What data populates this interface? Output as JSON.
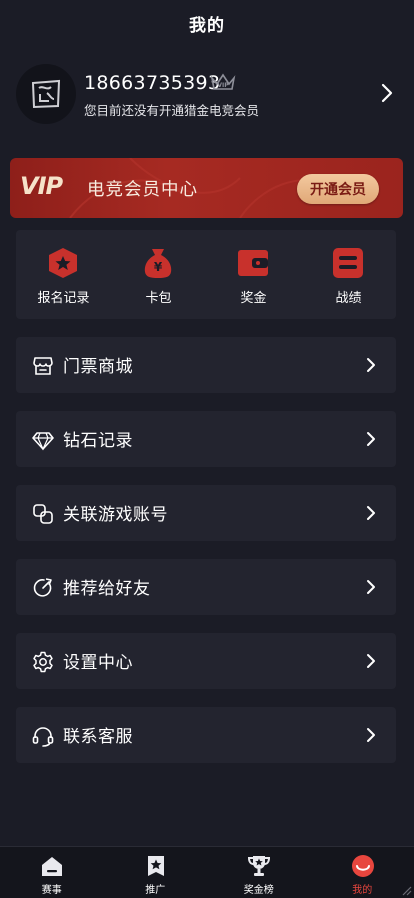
{
  "header": {
    "title": "我的"
  },
  "profile": {
    "phone": "18663735393",
    "subtext": "您目前还没有开通猎金电竞会员",
    "crown_label": "VIP"
  },
  "vip_banner": {
    "logo": "VIP",
    "title": "电竞会员中心",
    "button_label": "开通会员",
    "colors": {
      "background": "#9b241e",
      "button": "#e9b88a",
      "button_text": "#7a1b14"
    }
  },
  "quick_actions": [
    {
      "label": "报名记录",
      "icon": "registration-icon"
    },
    {
      "label": "卡包",
      "icon": "card-bag-icon"
    },
    {
      "label": "奖金",
      "icon": "wallet-icon"
    },
    {
      "label": "战绩",
      "icon": "record-icon"
    }
  ],
  "menu": [
    {
      "label": "门票商城",
      "icon": "store-icon"
    },
    {
      "label": "钻石记录",
      "icon": "diamond-icon"
    },
    {
      "label": "关联游戏账号",
      "icon": "link-icon"
    },
    {
      "label": "推荐给好友",
      "icon": "share-icon"
    },
    {
      "label": "设置中心",
      "icon": "gear-icon"
    },
    {
      "label": "联系客服",
      "icon": "headset-icon"
    }
  ],
  "tabbar": [
    {
      "label": "赛事",
      "icon": "home-icon",
      "active": false
    },
    {
      "label": "推广",
      "icon": "promo-icon",
      "active": false
    },
    {
      "label": "奖金榜",
      "icon": "trophy-icon",
      "active": false
    },
    {
      "label": "我的",
      "icon": "profile-smile-icon",
      "active": true
    }
  ],
  "colors": {
    "accent": "#e8463e",
    "page_bg": "#1b1c26",
    "card_bg": "#23242f",
    "icon_red": "#c8312c"
  }
}
